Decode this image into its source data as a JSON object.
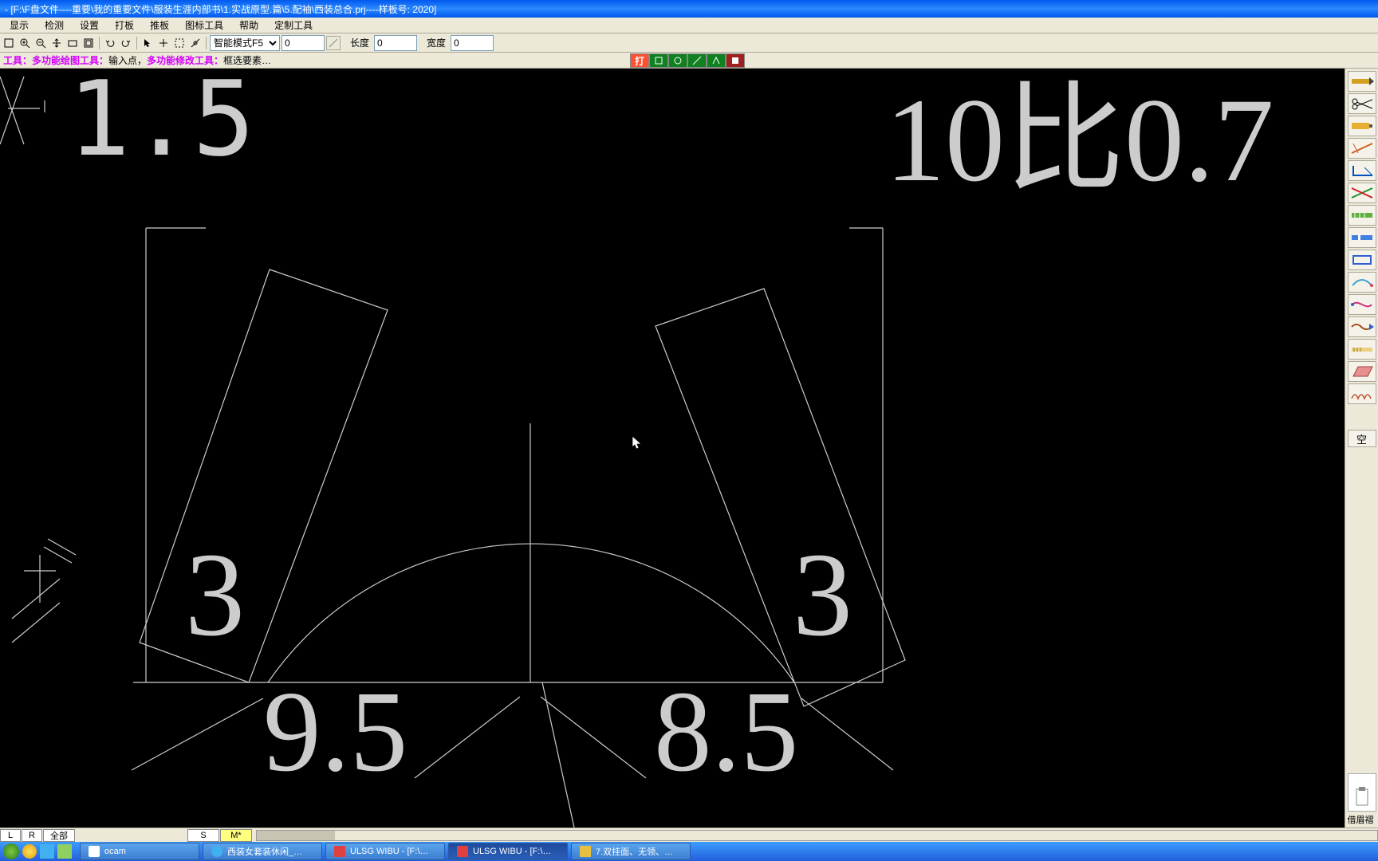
{
  "title": " - [F:\\F盘文件----重要\\我的重要文件\\服装生涯内部书\\1.实战原型.篇\\5.配袖\\西装总合.prj----样板号: 2020]",
  "menu": [
    "显示",
    "检测",
    "设置",
    "打板",
    "推板",
    "图标工具",
    "帮助",
    "定制工具"
  ],
  "toolbar": {
    "mode_select": "智能模式F5",
    "mode_val": "0",
    "len_label": "长度",
    "len_val": "0",
    "wid_label": "宽度",
    "wid_val": "0"
  },
  "hint": {
    "p1": "工具：多功能绘图工具：",
    "p2": "输入点，",
    "p3": "多功能修改工具：",
    "p4": "框选要素…"
  },
  "mid": {
    "da": "打"
  },
  "canvas": {
    "t1": "1.5",
    "t2": "10比0.7",
    "t3a": "3",
    "t3b": "3",
    "t4": "9.5",
    "t5": "8.5"
  },
  "sizes": {
    "L": "L",
    "R": "R",
    "all": "全部",
    "S": "S",
    "M": "M*"
  },
  "right_panel": {
    "kong": "空",
    "jie": "借眉褶"
  },
  "tasks": {
    "ocam": "ocam",
    "t1": "西装女套装休闲_…",
    "t2": "ULSG WIBU - [F:\\…",
    "t3": "ULSG WIBU - [F:\\…",
    "t4": "7.双挂面、无领、…"
  }
}
